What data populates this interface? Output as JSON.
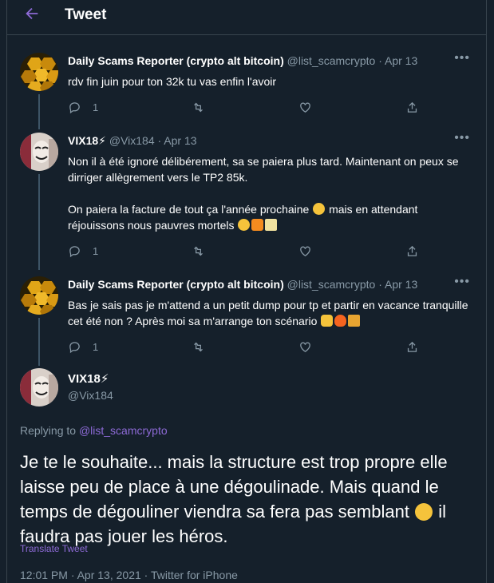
{
  "header": {
    "title": "Tweet"
  },
  "tweets": [
    {
      "name": "Daily Scams Reporter (crypto alt bitcoin)",
      "handle": "@list_scamcrypto",
      "date": "· Apr 13",
      "text": "rdv fin juin pour ton 32k tu vas enfin l'avoir",
      "reply_count": "1"
    },
    {
      "name": "VIX18⚡",
      "handle": "@Vix184",
      "date": "· Apr 13",
      "text_1": "Non il à été ignoré délibérement, sa se paiera plus tard. Maintenant on peux se dirriger allègrement vers le TP2 85k.",
      "text_2": "On paiera la facture de tout ça l'année prochaine",
      "text_3": "mais en attendant réjouissons nous pauvres mortels",
      "reply_count": "1"
    },
    {
      "name": "Daily Scams Reporter (crypto alt bitcoin)",
      "handle": "@list_scamcrypto",
      "date": "· Apr 13",
      "text": "Bas je sais pas je m'attend a un petit dump pour tp et partir en vacance tranquille cet été non ? Après moi sa m'arrange ton scénario",
      "reply_count": "1"
    }
  ],
  "main_tweet": {
    "name": "VIX18⚡",
    "handle": "@Vix184",
    "replying_prefix": "Replying to",
    "replying_to": "@list_scamcrypto",
    "text_1": "Je te le souhaite... mais la structure est trop propre elle laisse peu de place à une dégoulinade. Mais quand le temps de dégouliner viendra sa fera pas semblant",
    "text_2": "il faudra pas jouer les héros.",
    "translate": "Translate Tweet",
    "timestamp": "12:01 PM · Apr 13, 2021 · Twitter for iPhone"
  },
  "colors": {
    "background": "#15202b",
    "accent": "#8d6ad6",
    "muted": "#8899a6",
    "border": "#38444d"
  },
  "icons": [
    "back-arrow-icon",
    "reply-icon",
    "retweet-icon",
    "like-icon",
    "share-icon",
    "more-icon"
  ]
}
